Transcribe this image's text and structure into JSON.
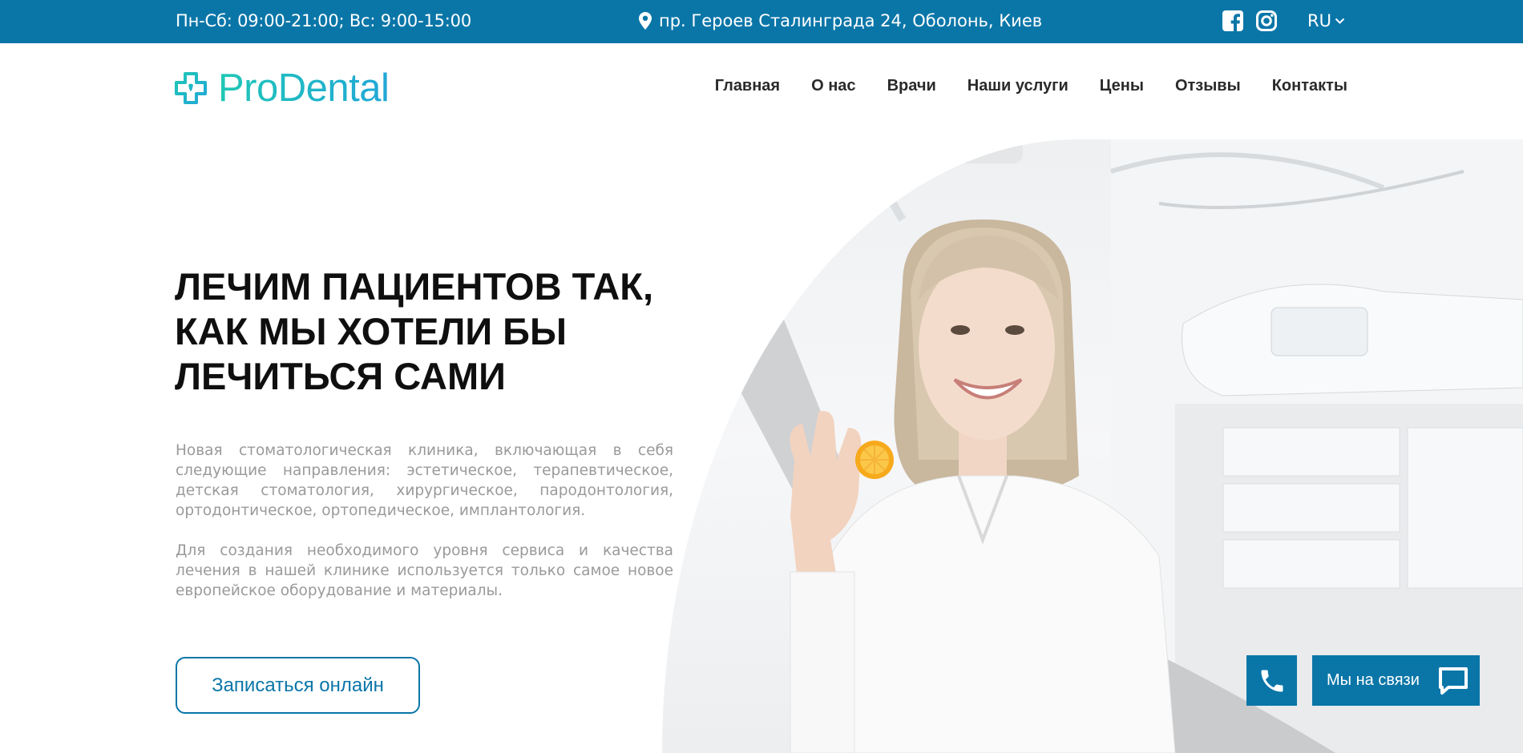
{
  "topbar": {
    "hours": "Пн-Сб: 09:00-21:00; Вс: 9:00-15:00",
    "address": "пр. Героев Сталинграда 24, Оболонь, Киев",
    "language": "RU",
    "icons": [
      "facebook-icon",
      "instagram-icon",
      "map-pin-icon",
      "chevron-down-icon"
    ]
  },
  "header": {
    "brand": "ProDental",
    "nav": [
      "Главная",
      "О нас",
      "Врачи",
      "Наши услуги",
      "Цены",
      "Отзывы",
      "Контакты"
    ]
  },
  "hero": {
    "title_lines": [
      "ЛЕЧИМ ПАЦИЕНТОВ ТАК,",
      "КАК МЫ ХОТЕЛИ БЫ",
      "ЛЕЧИТЬСЯ САМИ"
    ],
    "paragraph1": "Новая стоматологическая клиника, включающая в себя следующие направления: эстетическое, терапевтическое, детская стоматология, хирургическое, пародонтология, ортодонтическое, ортопедическое, имплантология.",
    "paragraph2": "Для создания необходимого уровня сервиса и качества лечения в нашей клинике используется только самое новое европейское оборудование и материалы.",
    "cta": "Записаться онлайн"
  },
  "widgets": {
    "chat_label": "Мы на связи"
  },
  "colors": {
    "brand_blue": "#0a76a8",
    "logo_gradient_start": "#1fc7b6",
    "logo_gradient_end": "#22a7d7",
    "body_text_gray": "#9a9a9a"
  }
}
